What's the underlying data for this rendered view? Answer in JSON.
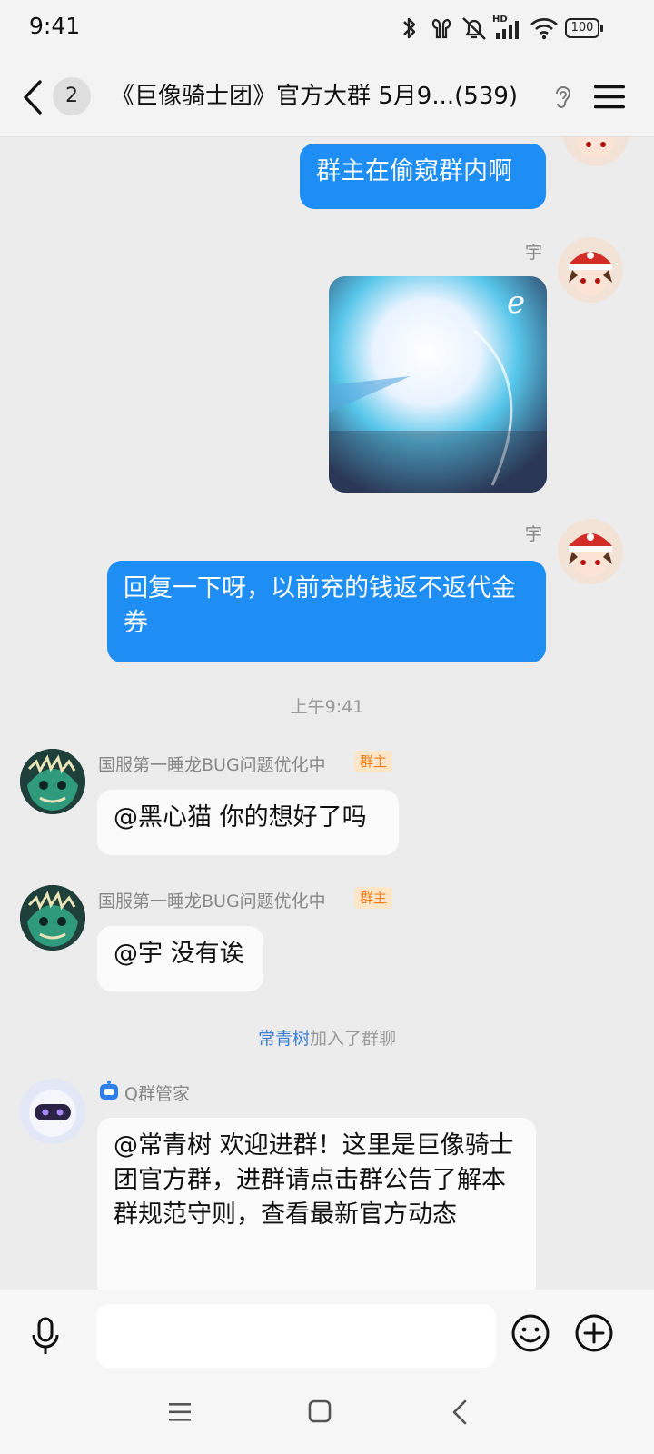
{
  "status": {
    "time": "9:41",
    "hd_label": "HD",
    "battery": "100"
  },
  "header": {
    "unread_count": "2",
    "title": "《巨像骑士团》官方大群 5月9...(539)"
  },
  "messages": [
    {
      "sender": "",
      "text": "群主在偷窥群内啊"
    },
    {
      "sender": "宇",
      "type": "image"
    },
    {
      "sender": "宇",
      "text": "回复一下呀，以前充的钱返不返代金券"
    },
    {
      "time": "上午9:41"
    },
    {
      "sender": "国服第一睡龙BUG问题优化中",
      "badge": "群主",
      "text": "@黑心猫 你的想好了吗"
    },
    {
      "sender": "国服第一睡龙BUG问题优化中",
      "badge": "群主",
      "text": "@宇 没有诶"
    },
    {
      "system_name": "常青树",
      "system_text": "加入了群聊"
    },
    {
      "sender": "Q群管家",
      "text": "@常青树 欢迎进群！这里是巨像骑士团官方群，进群请点击群公告了解本群规范守则，查看最新官方动态"
    }
  ],
  "input": {
    "placeholder": ""
  },
  "colors": {
    "accent": "#1e8ef5",
    "badge_text": "#ee7a1a",
    "badge_bg": "#fde5c8",
    "link": "#3d7fd6"
  },
  "icons": [
    "bluetooth-icon",
    "earbuds-icon",
    "mute-icon",
    "signal-icon",
    "wifi-icon",
    "battery-icon",
    "back-icon",
    "ear-icon",
    "menu-icon",
    "voice-icon",
    "emoji-icon",
    "plus-icon",
    "nav-menu-icon",
    "nav-home-icon",
    "nav-back-icon",
    "robot-icon"
  ]
}
